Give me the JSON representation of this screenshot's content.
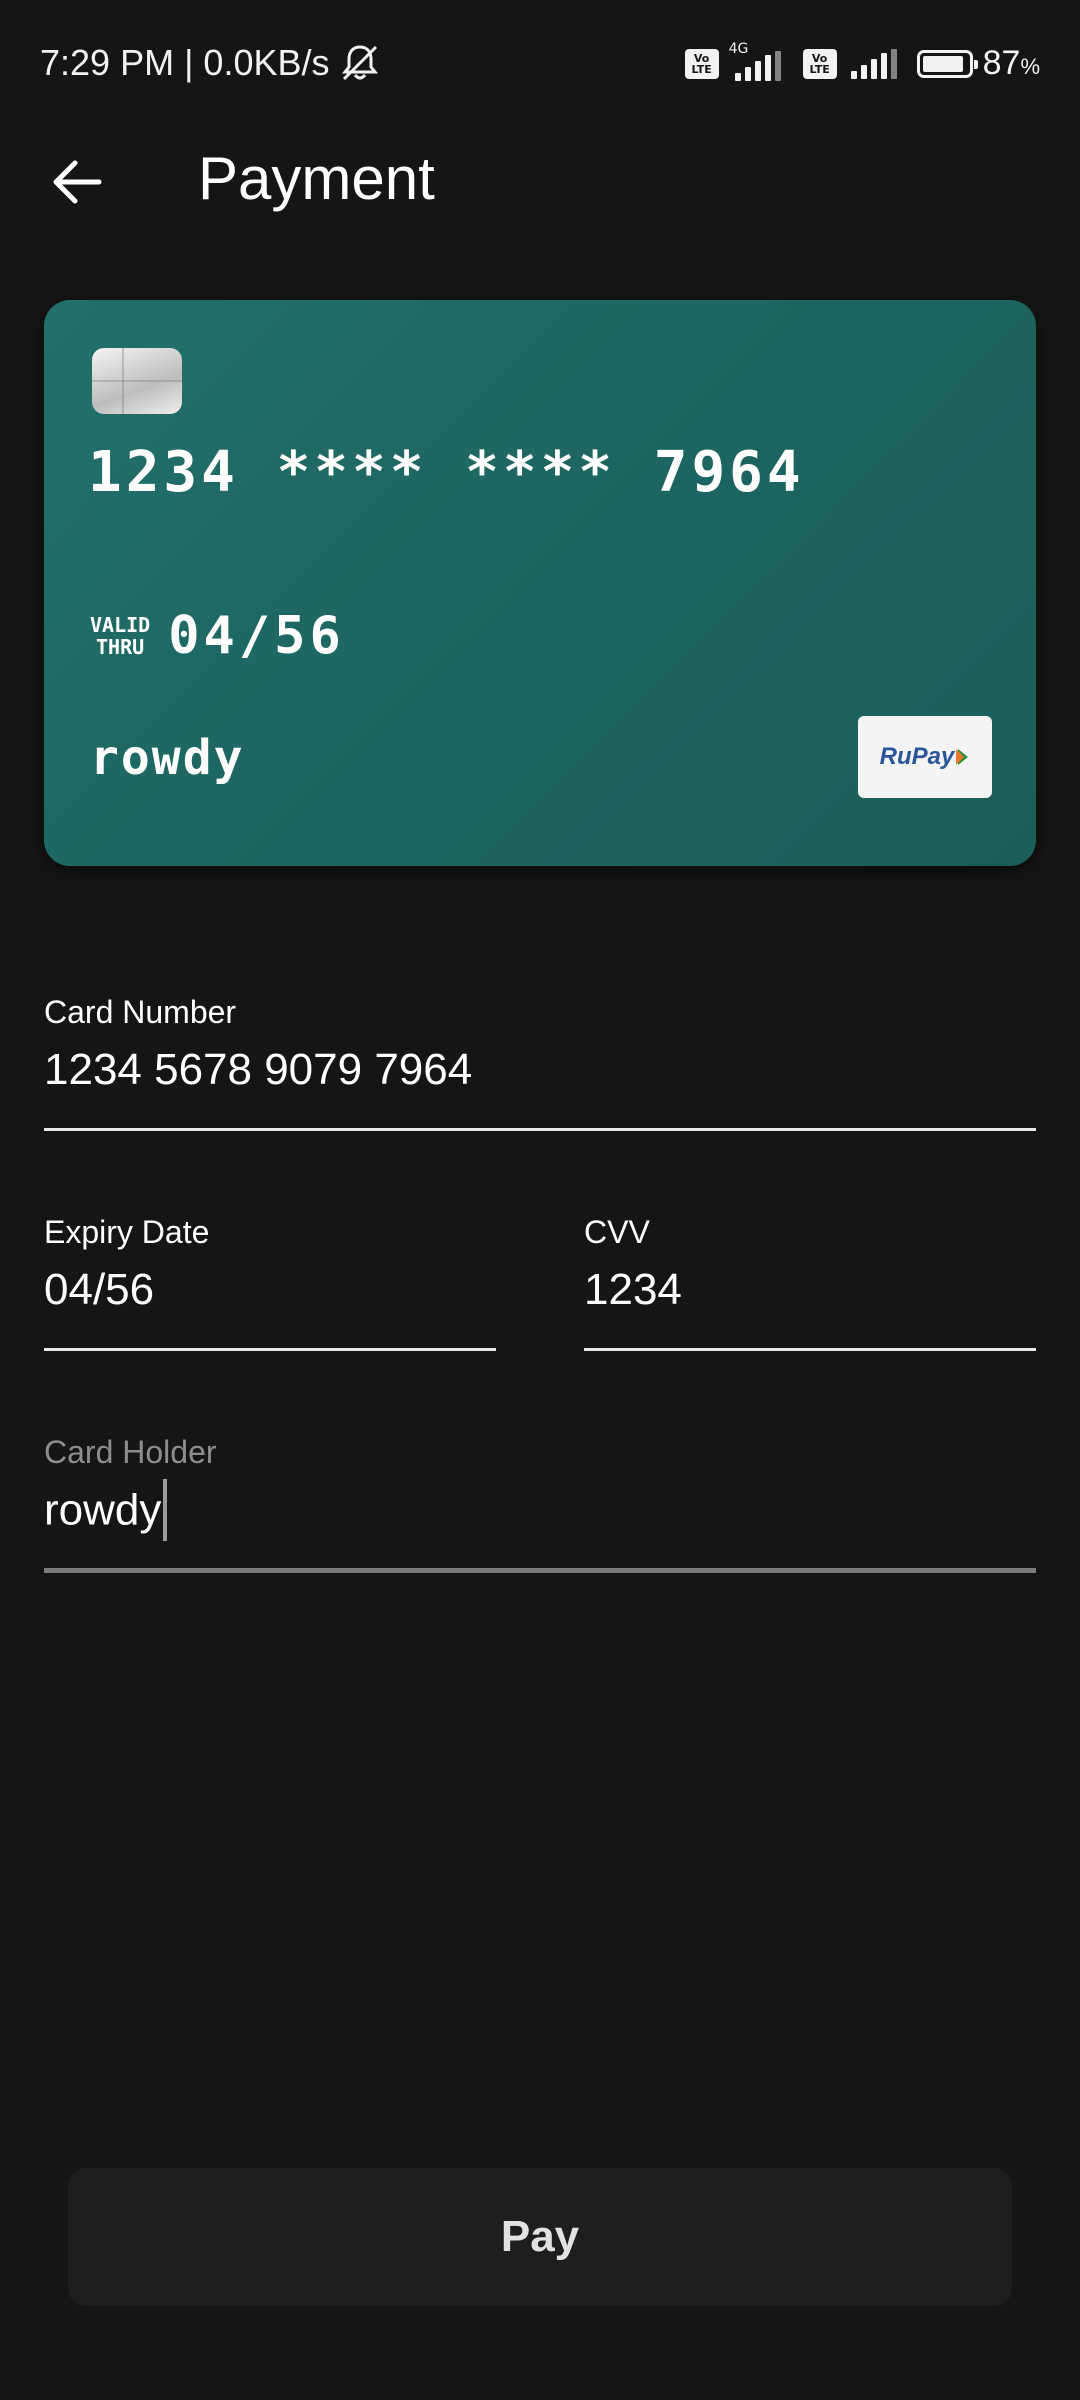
{
  "status_bar": {
    "time_speed": "7:29 PM | 0.0KB/s",
    "volte_top": "Vo",
    "volte_bottom": "LTE",
    "network_tag": "4G",
    "battery_value": "87",
    "battery_unit": "%",
    "icons": [
      "mute-bell-icon",
      "volte-icon",
      "signal-icon",
      "battery-icon"
    ]
  },
  "app_bar": {
    "title": "Payment",
    "back_icon": "arrow-left-icon"
  },
  "card": {
    "number": "1234 **** **** 7964",
    "valid_label_top": "VALID",
    "valid_label_bottom": "THRU",
    "expiry": "04/56",
    "holder": "rowdy",
    "brand": "RuPay",
    "color": "#1d6661"
  },
  "form": {
    "card_number": {
      "label": "Card Number",
      "value": "1234 5678 9079 7964"
    },
    "expiry_date": {
      "label": "Expiry Date",
      "value": "04/56"
    },
    "cvv": {
      "label": "CVV",
      "value": "1234"
    },
    "card_holder": {
      "label": "Card Holder",
      "value": "rowdy"
    }
  },
  "pay_button": {
    "label": "Pay"
  }
}
